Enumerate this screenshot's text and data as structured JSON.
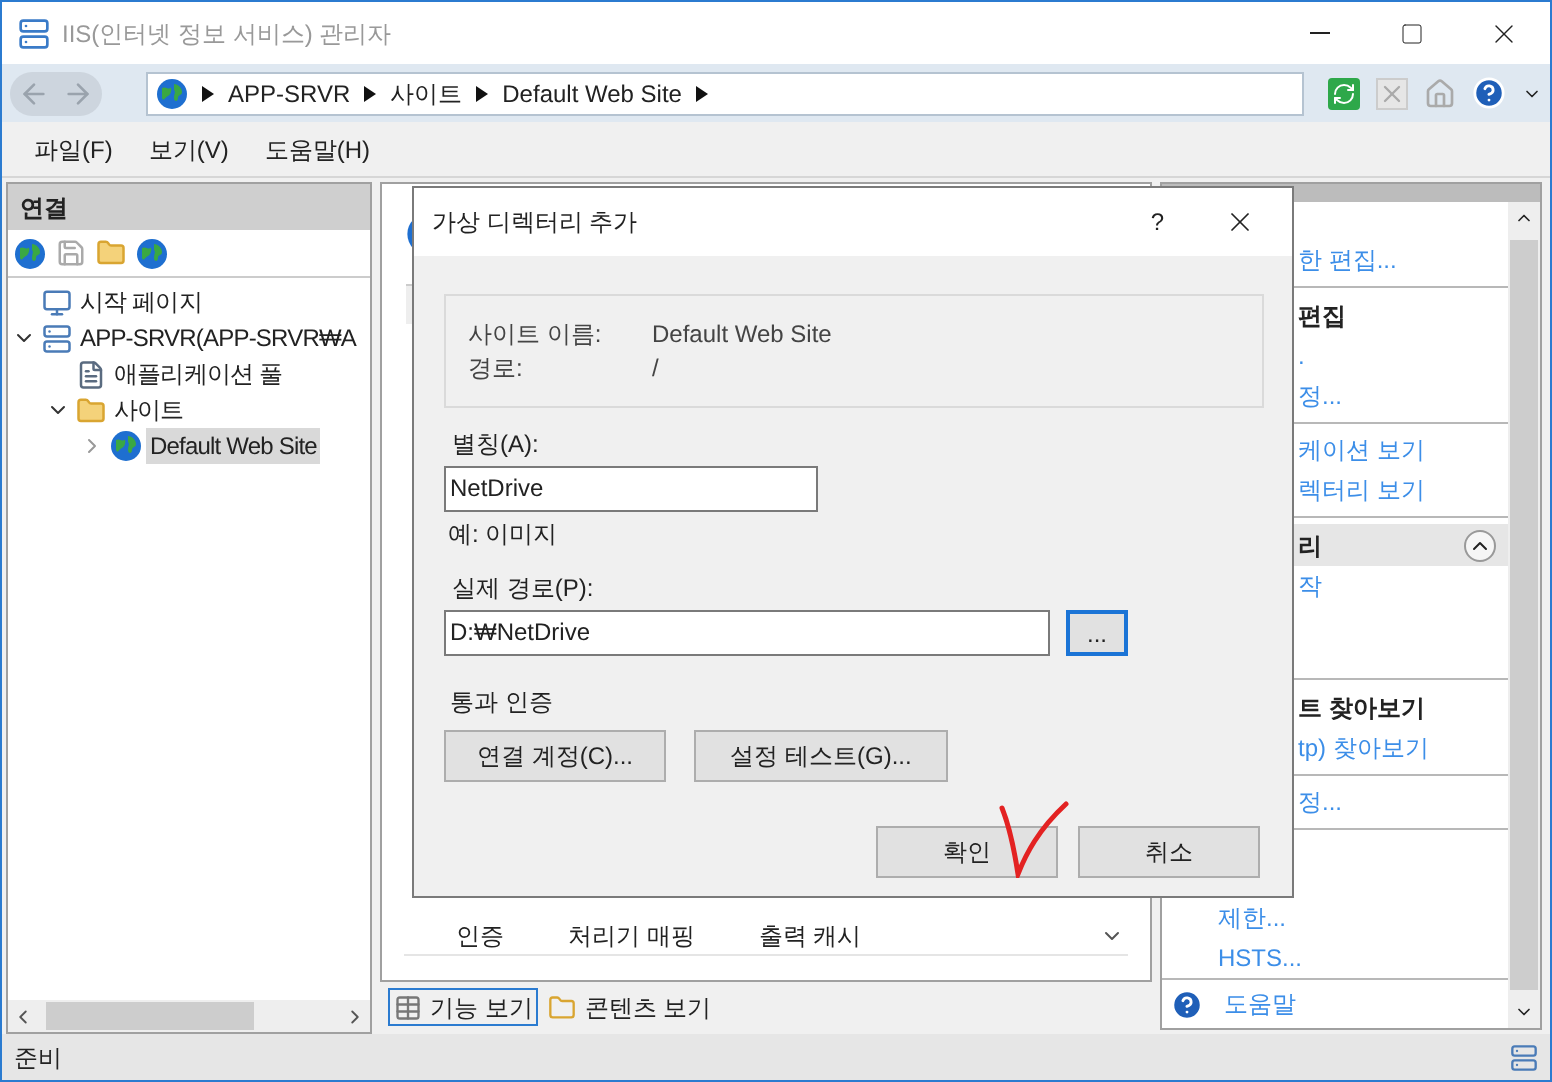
{
  "window": {
    "title": "IIS(인터넷 정보 서비스) 관리자"
  },
  "address_bar": {
    "crumbs": [
      "APP-SRVR",
      "사이트",
      "Default Web Site"
    ]
  },
  "menu": [
    "파일(F)",
    "보기(V)",
    "도움말(H)"
  ],
  "connections": {
    "title": "연결",
    "tree": [
      {
        "label": "시작 페이지",
        "kind": "page",
        "selected": false
      },
      {
        "label": "APP-SRVR(APP-SRVR₩A",
        "kind": "server",
        "selected": false,
        "expanded": true,
        "children": [
          {
            "label": "애플리케이션 풀",
            "kind": "pool",
            "selected": false
          },
          {
            "label": "사이트",
            "kind": "folder",
            "selected": false,
            "expanded": true,
            "children": [
              {
                "label": "Default Web Site",
                "kind": "site",
                "selected": true,
                "expanded": false
              }
            ]
          }
        ]
      }
    ]
  },
  "features": {
    "visible_row": [
      "인증",
      "처리기 매핑",
      "출력 캐시"
    ],
    "view_tabs": [
      {
        "label": "기능 보기",
        "selected": true
      },
      {
        "label": "콘텐츠 보기",
        "selected": false
      }
    ]
  },
  "actions": {
    "sections": [
      {
        "items": [
          {
            "kind": "link",
            "label": "한 편집..."
          }
        ]
      },
      {
        "heading": "편집",
        "items": [
          {
            "kind": "link",
            "label": "."
          },
          {
            "kind": "link",
            "label": "정..."
          }
        ]
      },
      {
        "items": [
          {
            "kind": "link",
            "label": "케이션 보기"
          },
          {
            "kind": "link",
            "label": "렉터리 보기"
          }
        ]
      },
      {
        "heading": "리",
        "collapsible": true,
        "items": [
          {
            "kind": "link",
            "label": "작"
          }
        ]
      },
      {
        "heading": "트 찾아보기",
        "items": [
          {
            "kind": "link",
            "label": "tp) 찾아보기"
          }
        ]
      },
      {
        "items": [
          {
            "kind": "link",
            "label": "정..."
          }
        ]
      },
      {
        "items": [
          {
            "kind": "link",
            "label": "제한..."
          },
          {
            "kind": "link",
            "label": "HSTS..."
          }
        ]
      },
      {
        "items": [
          {
            "kind": "help",
            "label": "도움말"
          }
        ]
      }
    ]
  },
  "dialog": {
    "title": "가상 디렉터리 추가",
    "help_glyph": "?",
    "info": [
      {
        "label": "사이트 이름:",
        "value": "Default Web Site"
      },
      {
        "label": "경로:",
        "value": "/"
      }
    ],
    "alias": {
      "label": "별칭(A):",
      "value": "NetDrive",
      "example": "예: 이미지"
    },
    "physical_path": {
      "label": "실제 경로(P):",
      "value": "D:₩NetDrive",
      "browse": "..."
    },
    "pass_through": {
      "title": "통과 인증",
      "buttons": [
        "연결 계정(C)...",
        "설정 테스트(G)..."
      ]
    },
    "buttons": [
      "확인",
      "취소"
    ]
  },
  "status_bar": {
    "text": "준비"
  }
}
